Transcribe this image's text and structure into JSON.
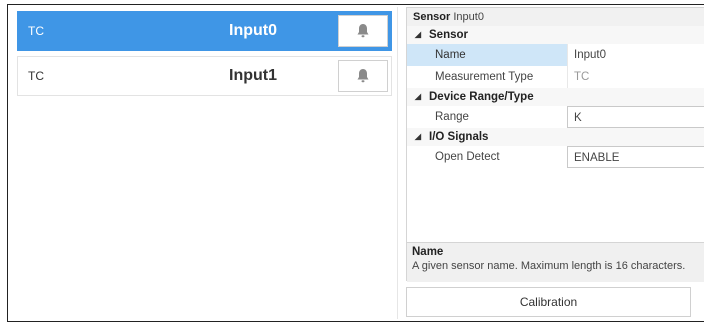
{
  "sensors": [
    {
      "type": "TC",
      "name": "Input0",
      "selected": true,
      "icon": "bell-icon"
    },
    {
      "type": "TC",
      "name": "Input1",
      "selected": false,
      "icon": "bell-icon"
    }
  ],
  "properties": {
    "header_label": "Sensor",
    "header_value": "Input0",
    "categories": [
      {
        "label": "Sensor"
      },
      {
        "label": "Device Range/Type"
      },
      {
        "label": "I/O Signals"
      }
    ],
    "rows": {
      "name": {
        "label": "Name",
        "value": "Input0"
      },
      "measurement_type": {
        "label": "Measurement Type",
        "value": "TC"
      },
      "range": {
        "label": "Range",
        "value": "K"
      },
      "open_detect": {
        "label": "Open Detect",
        "value": "ENABLE"
      }
    },
    "description": {
      "title": "Name",
      "text": "A given sensor name. Maximum length is 16 characters."
    }
  },
  "buttons": {
    "calibration": "Calibration"
  },
  "colors": {
    "selection": "#3f96e6",
    "property_selection": "#cfe6f8"
  }
}
